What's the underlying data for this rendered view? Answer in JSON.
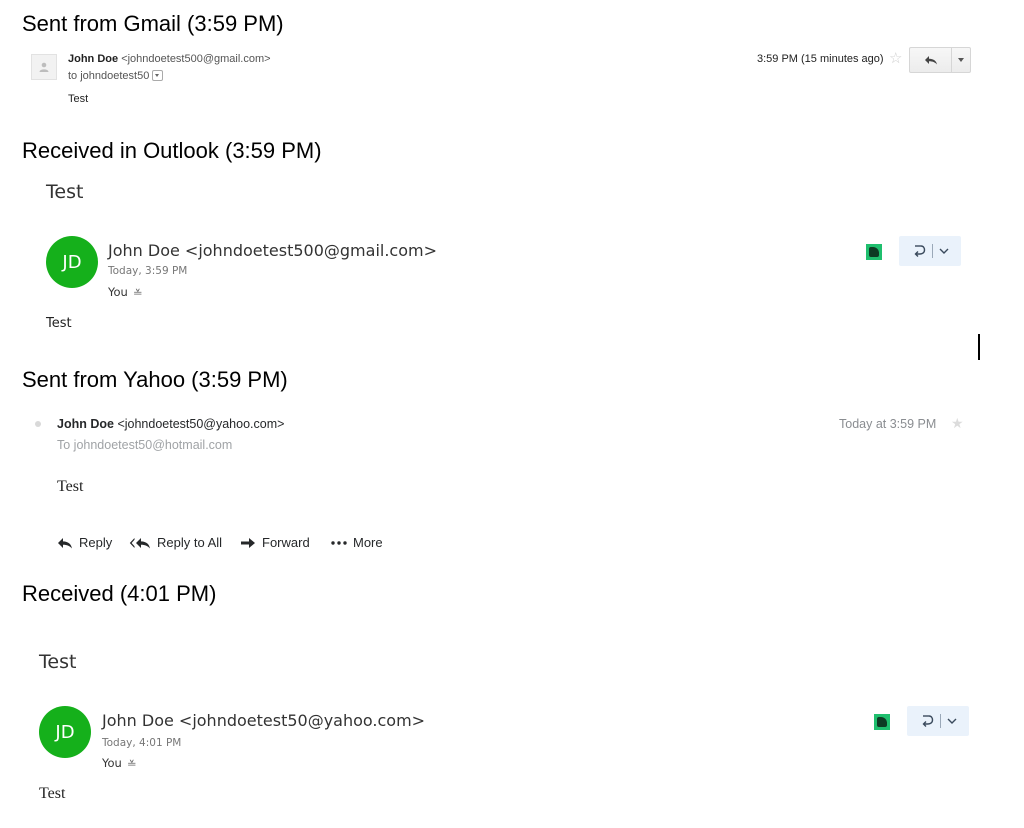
{
  "gmail": {
    "heading": "Sent from Gmail (3:59 PM)",
    "sender_name": "John Doe",
    "sender_email": "<johndoetest500@gmail.com>",
    "to_line": "to johndoetest50",
    "body": "Test",
    "time": "3:59 PM (15 minutes ago)",
    "icons": [
      "avatar-placeholder-icon",
      "dropdown-icon",
      "star-icon",
      "reply-icon",
      "more-options-icon"
    ]
  },
  "outlook_received": {
    "heading": "Received in Outlook (3:59 PM)",
    "subject": "Test",
    "avatar_initials": "JD",
    "sender": "John Doe <johndoetest500@gmail.com>",
    "date": "Today, 3:59 PM",
    "recipient": "You",
    "body": "Test",
    "avatar_color": "#15b01b",
    "icons": [
      "add-in-icon",
      "reply-icon",
      "chevron-down-icon",
      "expand-recipients-icon"
    ]
  },
  "yahoo": {
    "heading": "Sent from Yahoo (3:59 PM)",
    "sender_name": "John Doe",
    "sender_email": "<johndoetest50@yahoo.com>",
    "to_line": "To  johndoetest50@hotmail.com",
    "body": "Test",
    "time": "Today at 3:59 PM",
    "actions": {
      "reply": "Reply",
      "reply_all": "Reply to All",
      "forward": "Forward",
      "more": "More"
    },
    "icons": [
      "status-dot-icon",
      "star-icon",
      "reply-icon",
      "reply-all-icon",
      "forward-icon",
      "more-icon"
    ]
  },
  "received_second": {
    "heading": "Received (4:01 PM)",
    "subject": "Test",
    "avatar_initials": "JD",
    "sender": "John Doe <johndoetest50@yahoo.com>",
    "date": "Today, 4:01 PM",
    "recipient": "You",
    "body": "Test",
    "avatar_color": "#15b01b",
    "icons": [
      "add-in-icon",
      "reply-icon",
      "chevron-down-icon",
      "expand-recipients-icon"
    ]
  }
}
